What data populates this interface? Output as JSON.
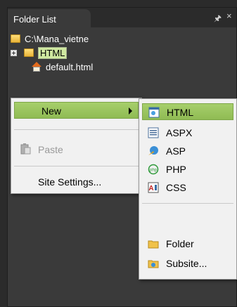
{
  "panel": {
    "title": "Folder List",
    "pin_icon": "pin-icon",
    "close_icon": "close-icon"
  },
  "tree": {
    "root_path": "C:\\Mana_vietne",
    "html_folder": "HTML",
    "default_file": "default.html"
  },
  "context_menu": {
    "new_label": "New",
    "paste_label": "Paste",
    "site_settings_label": "Site Settings..."
  },
  "submenu": {
    "items": [
      "HTML",
      "ASPX",
      "ASP",
      "PHP",
      "CSS",
      "Folder",
      "Subsite..."
    ]
  },
  "colors": {
    "highlight": "#9dc65e",
    "panel_bg": "#3a3a3a",
    "menu_bg": "#f1f1f1"
  }
}
